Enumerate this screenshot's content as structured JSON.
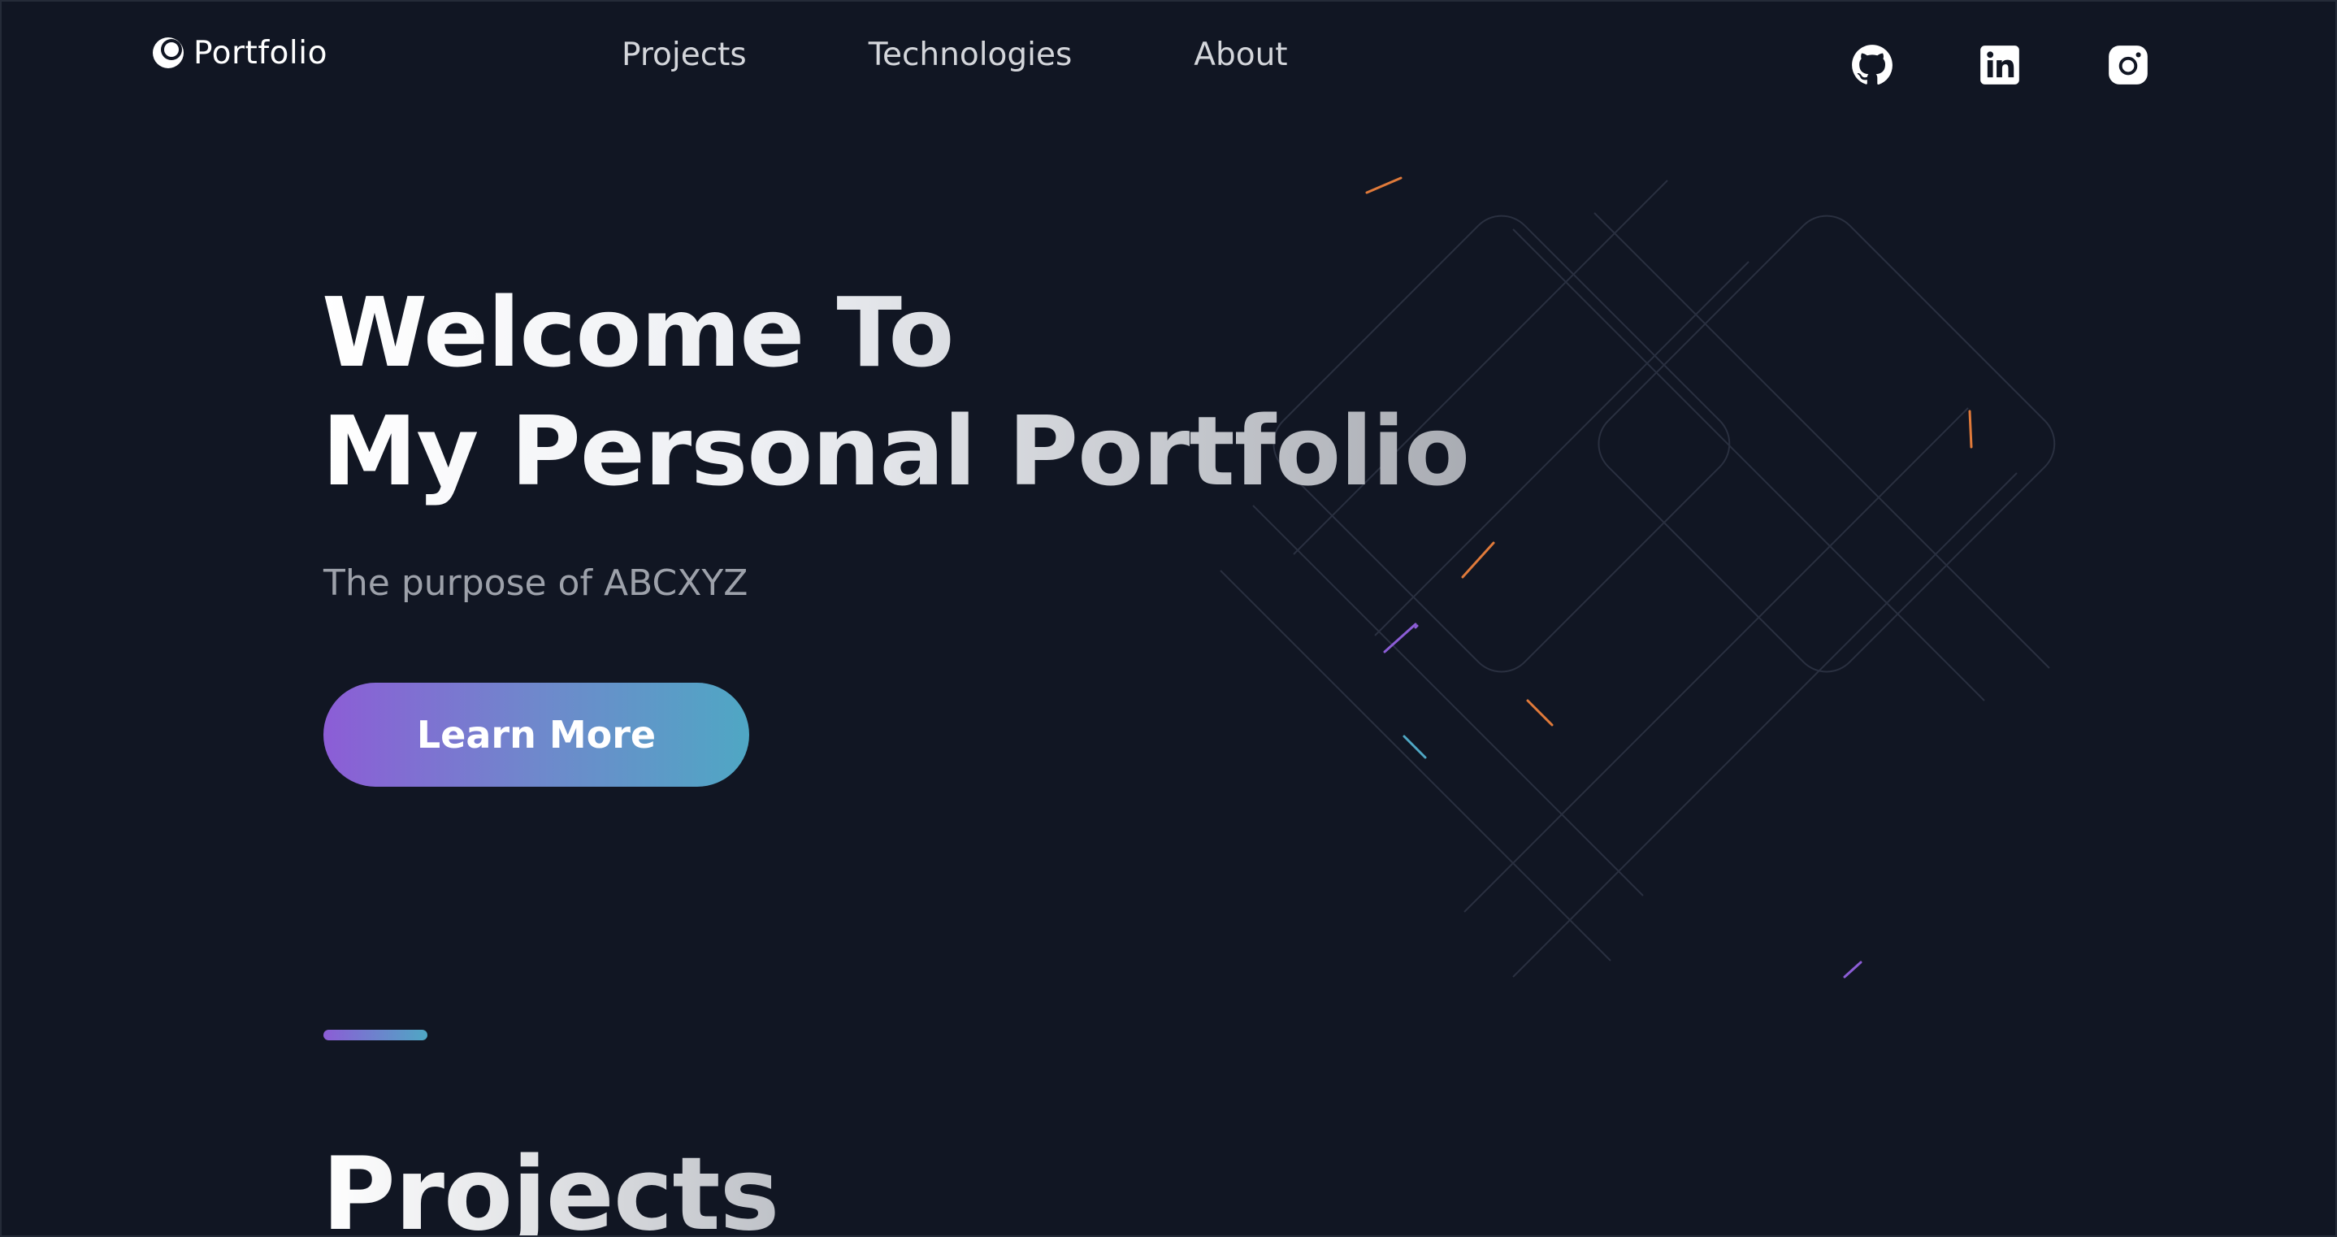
{
  "brand": {
    "name": "Portfolio",
    "logo_icon": "crescent-logo-icon"
  },
  "nav": {
    "items": [
      {
        "label": "Projects"
      },
      {
        "label": "Technologies"
      },
      {
        "label": "About"
      }
    ]
  },
  "social": [
    {
      "icon": "github-icon"
    },
    {
      "icon": "linkedin-icon"
    },
    {
      "icon": "instagram-icon"
    }
  ],
  "hero": {
    "title_line1": "Welcome To",
    "title_line2": "My Personal Portfolio",
    "subtitle": "The purpose of ABCXYZ",
    "cta_label": "Learn More"
  },
  "sections": {
    "projects_title": "Projects"
  },
  "colors": {
    "background": "#111623",
    "accent_start": "#8c5dd6",
    "accent_end": "#4fa7c4",
    "nav_text": "#d4d6db",
    "muted_text": "#9da1aa"
  }
}
